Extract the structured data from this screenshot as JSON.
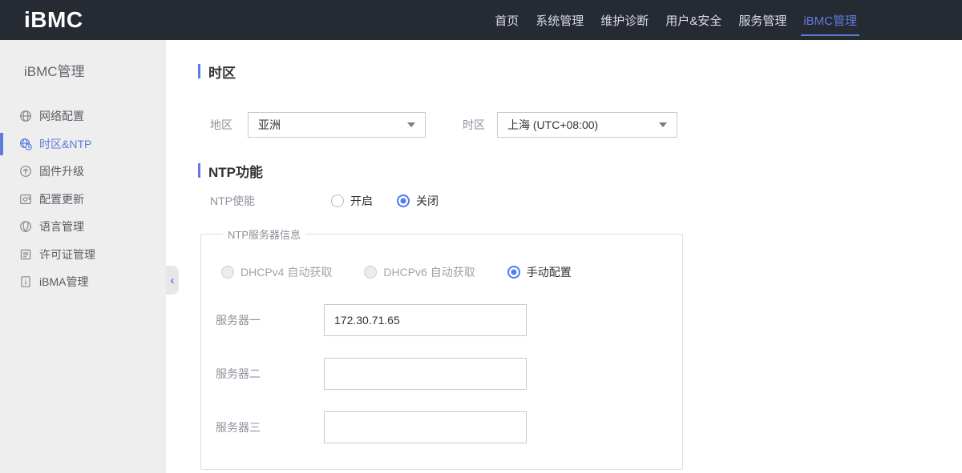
{
  "topbar": {
    "logo": "iBMC",
    "nav": [
      {
        "label": "首页",
        "active": false
      },
      {
        "label": "系统管理",
        "active": false
      },
      {
        "label": "维护诊断",
        "active": false
      },
      {
        "label": "用户&安全",
        "active": false
      },
      {
        "label": "服务管理",
        "active": false
      },
      {
        "label": "iBMC管理",
        "active": true
      }
    ]
  },
  "sidebar": {
    "title": "iBMC管理",
    "collapse_icon": "‹",
    "items": [
      {
        "label": "网络配置",
        "icon": "network-config-icon",
        "active": false
      },
      {
        "label": "时区&NTP",
        "icon": "timezone-ntp-icon",
        "active": true
      },
      {
        "label": "固件升级",
        "icon": "firmware-upgrade-icon",
        "active": false
      },
      {
        "label": "配置更新",
        "icon": "config-update-icon",
        "active": false
      },
      {
        "label": "语言管理",
        "icon": "language-icon",
        "active": false
      },
      {
        "label": "许可证管理",
        "icon": "license-icon",
        "active": false
      },
      {
        "label": "iBMA管理",
        "icon": "ibma-icon",
        "active": false
      }
    ]
  },
  "main": {
    "timezone_section": {
      "title": "时区",
      "region_label": "地区",
      "region_value": "亚洲",
      "timezone_label": "时区",
      "timezone_value": "上海 (UTC+08:00)"
    },
    "ntp_section": {
      "title": "NTP功能",
      "enable_label": "NTP使能",
      "enable_options": [
        {
          "label": "开启",
          "selected": false
        },
        {
          "label": "关闭",
          "selected": true
        }
      ],
      "server_group": {
        "legend": "NTP服务器信息",
        "mode_options": [
          {
            "label": "DHCPv4 自动获取",
            "selected": false,
            "disabled": true
          },
          {
            "label": "DHCPv6 自动获取",
            "selected": false,
            "disabled": true
          },
          {
            "label": "手动配置",
            "selected": true,
            "disabled": false
          }
        ],
        "servers": [
          {
            "label": "服务器一",
            "value": "172.30.71.65"
          },
          {
            "label": "服务器二",
            "value": ""
          },
          {
            "label": "服务器三",
            "value": ""
          }
        ]
      }
    }
  },
  "colors": {
    "accent": "#5e7ce0",
    "radio_selected": "#4d7df0",
    "topbar_bg": "#262a33",
    "sidebar_bg": "#eeeeee"
  }
}
